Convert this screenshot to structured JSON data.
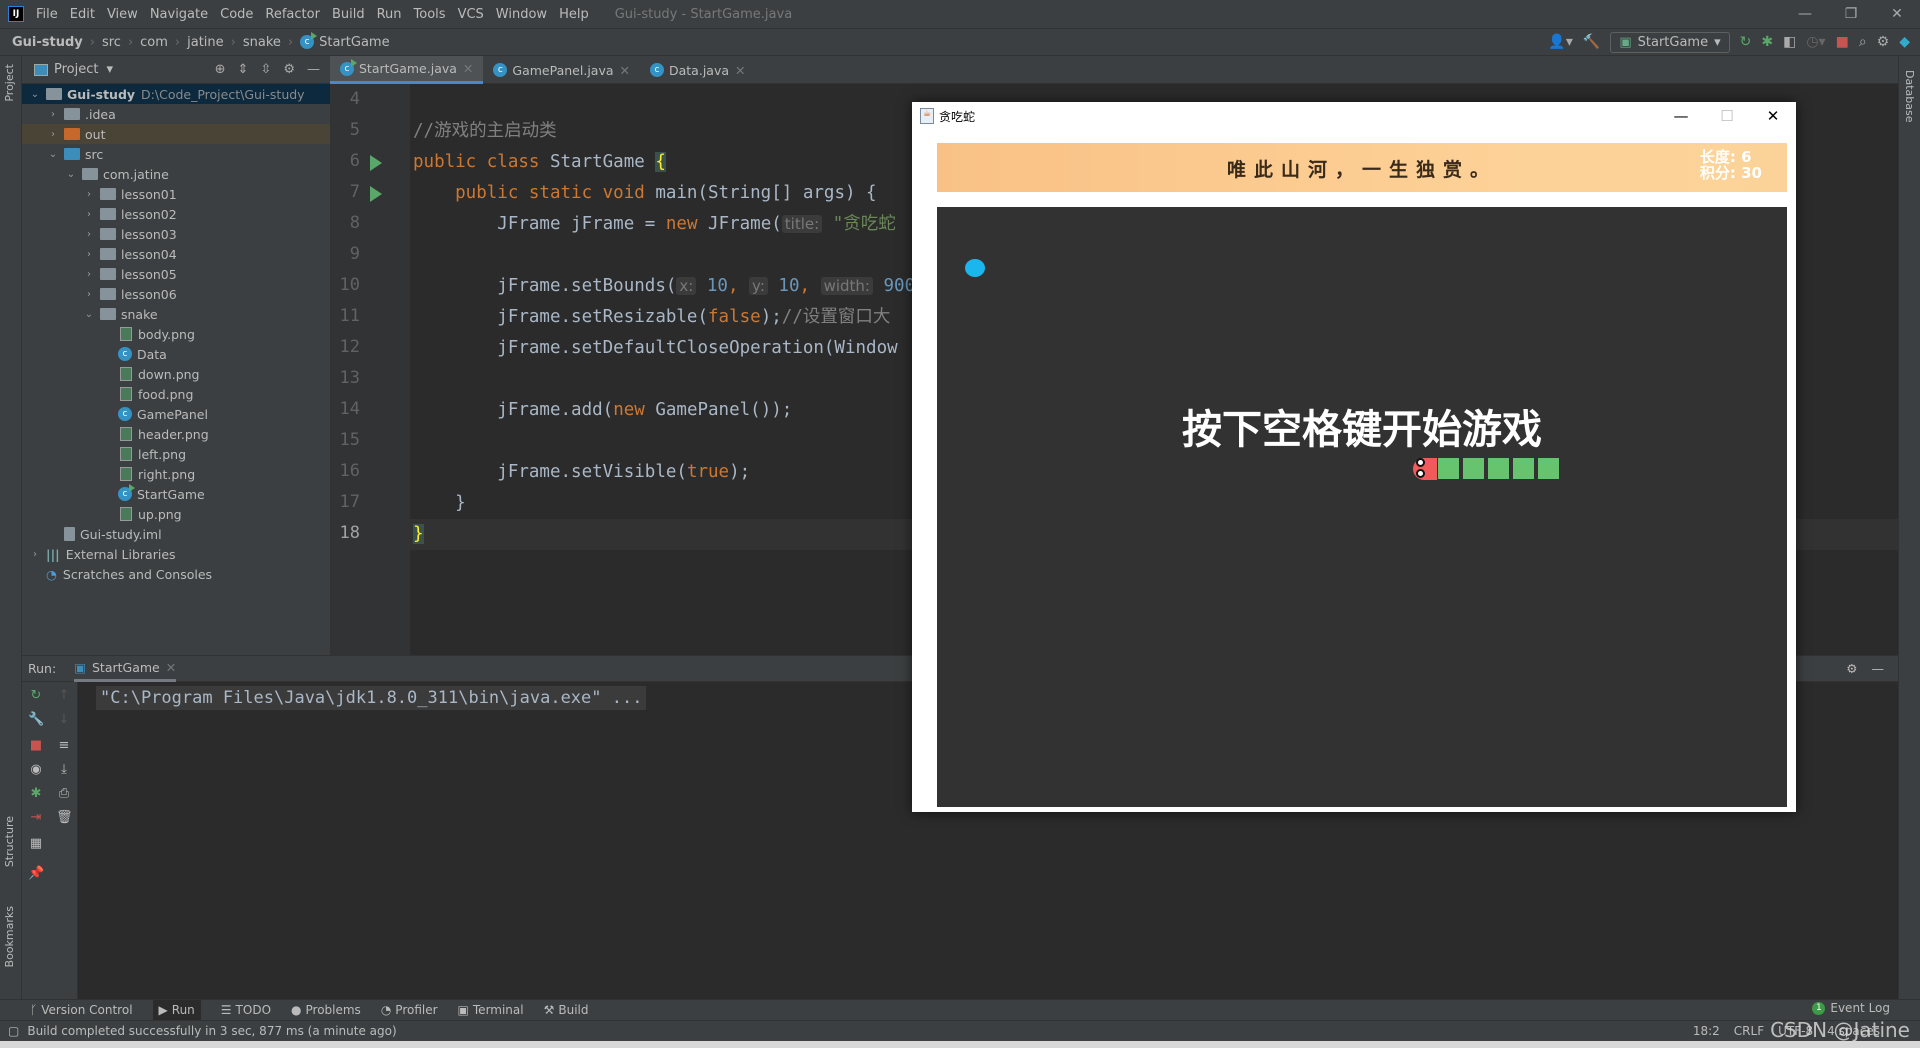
{
  "menu": {
    "items": [
      "File",
      "Edit",
      "View",
      "Navigate",
      "Code",
      "Refactor",
      "Build",
      "Run",
      "Tools",
      "VCS",
      "Window",
      "Help"
    ],
    "window_title": "Gui-study - StartGame.java"
  },
  "breadcrumb": [
    "Gui-study",
    "src",
    "com",
    "jatine",
    "snake",
    "StartGame"
  ],
  "toolbar": {
    "run_config": "StartGame"
  },
  "left_strip": {
    "project": "Project",
    "structure": "Structure",
    "bookmarks": "Bookmarks"
  },
  "right_strip": {
    "database": "Database"
  },
  "project": {
    "title": "Project",
    "tree": [
      {
        "label": "Gui-study",
        "path": "D:\\Code_Project\\Gui-study",
        "depth": 0,
        "arrow": "open",
        "icon": "module-folder",
        "selected": true
      },
      {
        "label": ".idea",
        "depth": 1,
        "arrow": "closed",
        "icon": "folder"
      },
      {
        "label": "out",
        "depth": 1,
        "arrow": "closed",
        "icon": "folder-excluded",
        "highlight": true
      },
      {
        "label": "src",
        "depth": 1,
        "arrow": "open",
        "icon": "folder-source"
      },
      {
        "label": "com.jatine",
        "depth": 2,
        "arrow": "open",
        "icon": "package"
      },
      {
        "label": "lesson01",
        "depth": 3,
        "arrow": "closed",
        "icon": "package"
      },
      {
        "label": "lesson02",
        "depth": 3,
        "arrow": "closed",
        "icon": "package"
      },
      {
        "label": "lesson03",
        "depth": 3,
        "arrow": "closed",
        "icon": "package"
      },
      {
        "label": "lesson04",
        "depth": 3,
        "arrow": "closed",
        "icon": "package"
      },
      {
        "label": "lesson05",
        "depth": 3,
        "arrow": "closed",
        "icon": "package"
      },
      {
        "label": "lesson06",
        "depth": 3,
        "arrow": "closed",
        "icon": "package"
      },
      {
        "label": "snake",
        "depth": 3,
        "arrow": "open",
        "icon": "package"
      },
      {
        "label": "body.png",
        "depth": 4,
        "icon": "image"
      },
      {
        "label": "Data",
        "depth": 4,
        "icon": "class"
      },
      {
        "label": "down.png",
        "depth": 4,
        "icon": "image"
      },
      {
        "label": "food.png",
        "depth": 4,
        "icon": "image"
      },
      {
        "label": "GamePanel",
        "depth": 4,
        "icon": "class"
      },
      {
        "label": "header.png",
        "depth": 4,
        "icon": "image"
      },
      {
        "label": "left.png",
        "depth": 4,
        "icon": "image"
      },
      {
        "label": "right.png",
        "depth": 4,
        "icon": "image"
      },
      {
        "label": "StartGame",
        "depth": 4,
        "icon": "class-runnable"
      },
      {
        "label": "up.png",
        "depth": 4,
        "icon": "image"
      },
      {
        "label": "Gui-study.iml",
        "depth": 1,
        "icon": "iml"
      },
      {
        "label": "External Libraries",
        "depth": 0,
        "arrow": "closed",
        "icon": "libraries"
      },
      {
        "label": "Scratches and Consoles",
        "depth": 0,
        "icon": "scratches"
      }
    ]
  },
  "editor": {
    "tabs": [
      {
        "label": "StartGame.java",
        "active": true,
        "icon": "class-runnable"
      },
      {
        "label": "GamePanel.java",
        "icon": "class"
      },
      {
        "label": "Data.java",
        "icon": "class"
      }
    ],
    "current_line": 18,
    "lines": [
      {
        "n": 4,
        "tokens": []
      },
      {
        "n": 5,
        "tokens": [
          {
            "t": "//游戏的主启动类",
            "c": "cmt"
          }
        ]
      },
      {
        "n": 6,
        "run": true,
        "tokens": [
          {
            "t": "public class ",
            "c": "kw"
          },
          {
            "t": "StartGame ",
            "c": "pl"
          },
          {
            "t": "{",
            "c": "brace"
          }
        ]
      },
      {
        "n": 7,
        "run": true,
        "tokens": [
          {
            "t": "    public static void ",
            "c": "kw"
          },
          {
            "t": "main(String[] args) {",
            "c": "pl"
          }
        ]
      },
      {
        "n": 8,
        "tokens": [
          {
            "t": "        JFrame jFrame = ",
            "c": "pl"
          },
          {
            "t": "new ",
            "c": "kw"
          },
          {
            "t": "JFrame(",
            "c": "pl"
          },
          {
            "t": "title:",
            "c": "hint"
          },
          {
            "t": " \"贪吃蛇",
            "c": "str"
          }
        ]
      },
      {
        "n": 9,
        "tokens": []
      },
      {
        "n": 10,
        "tokens": [
          {
            "t": "        jFrame.setBounds(",
            "c": "pl"
          },
          {
            "t": "x:",
            "c": "hint"
          },
          {
            "t": " 10",
            "c": "num"
          },
          {
            "t": ", ",
            "c": "kw"
          },
          {
            "t": "y:",
            "c": "hint"
          },
          {
            "t": " 10",
            "c": "num"
          },
          {
            "t": ", ",
            "c": "kw"
          },
          {
            "t": "width:",
            "c": "hint"
          },
          {
            "t": " 900",
            "c": "num"
          },
          {
            "t": ",",
            "c": "kw"
          }
        ]
      },
      {
        "n": 11,
        "tokens": [
          {
            "t": "        jFrame.setResizable(",
            "c": "pl"
          },
          {
            "t": "false",
            "c": "kw"
          },
          {
            "t": ");",
            "c": "pl"
          },
          {
            "t": "//设置窗口大",
            "c": "cmt"
          }
        ]
      },
      {
        "n": 12,
        "tokens": [
          {
            "t": "        jFrame.setDefaultCloseOperation(Window",
            "c": "pl"
          }
        ]
      },
      {
        "n": 13,
        "tokens": []
      },
      {
        "n": 14,
        "tokens": [
          {
            "t": "        jFrame.add(",
            "c": "pl"
          },
          {
            "t": "new ",
            "c": "kw"
          },
          {
            "t": "GamePanel());",
            "c": "pl"
          }
        ]
      },
      {
        "n": 15,
        "tokens": []
      },
      {
        "n": 16,
        "tokens": [
          {
            "t": "        jFrame.setVisible(",
            "c": "pl"
          },
          {
            "t": "true",
            "c": "kw"
          },
          {
            "t": ");",
            "c": "pl"
          }
        ]
      },
      {
        "n": 17,
        "tokens": [
          {
            "t": "    }",
            "c": "pl"
          }
        ]
      },
      {
        "n": 18,
        "tokens": [
          {
            "t": "}",
            "c": "brace"
          }
        ]
      }
    ]
  },
  "run": {
    "label": "Run:",
    "tab": "StartGame",
    "console": "\"C:\\Program Files\\Java\\jdk1.8.0_311\\bin\\java.exe\" ..."
  },
  "bottom_tools": [
    {
      "label": "Version Control",
      "icon": "branch-icon"
    },
    {
      "label": "Run",
      "icon": "run-icon",
      "active": true
    },
    {
      "label": "TODO",
      "icon": "list-icon"
    },
    {
      "label": "Problems",
      "icon": "problems-icon"
    },
    {
      "label": "Profiler",
      "icon": "profiler-icon"
    },
    {
      "label": "Terminal",
      "icon": "terminal-icon"
    },
    {
      "label": "Build",
      "icon": "hammer-icon"
    }
  ],
  "event_log": {
    "label": "Event Log",
    "count": "1"
  },
  "status": {
    "message": "Build completed successfully in 3 sec, 877 ms (a minute ago)",
    "position": "18:2",
    "line_sep": "CRLF",
    "encoding": "UTF-8",
    "indent": "4 spaces"
  },
  "watermark": "CSDN @Jatine",
  "game": {
    "title": "贪吃蛇",
    "motto": "唯此山河，一生独赏。",
    "length_label": "长度:",
    "length": "6",
    "score_label": "积分:",
    "score": "30",
    "prompt": "按下空格键开始游戏",
    "snake_body_segments": 5,
    "colors": {
      "board": "#323232",
      "food": "#1ab6ed",
      "body": "#66c36e",
      "head": "#f05a5a"
    }
  }
}
